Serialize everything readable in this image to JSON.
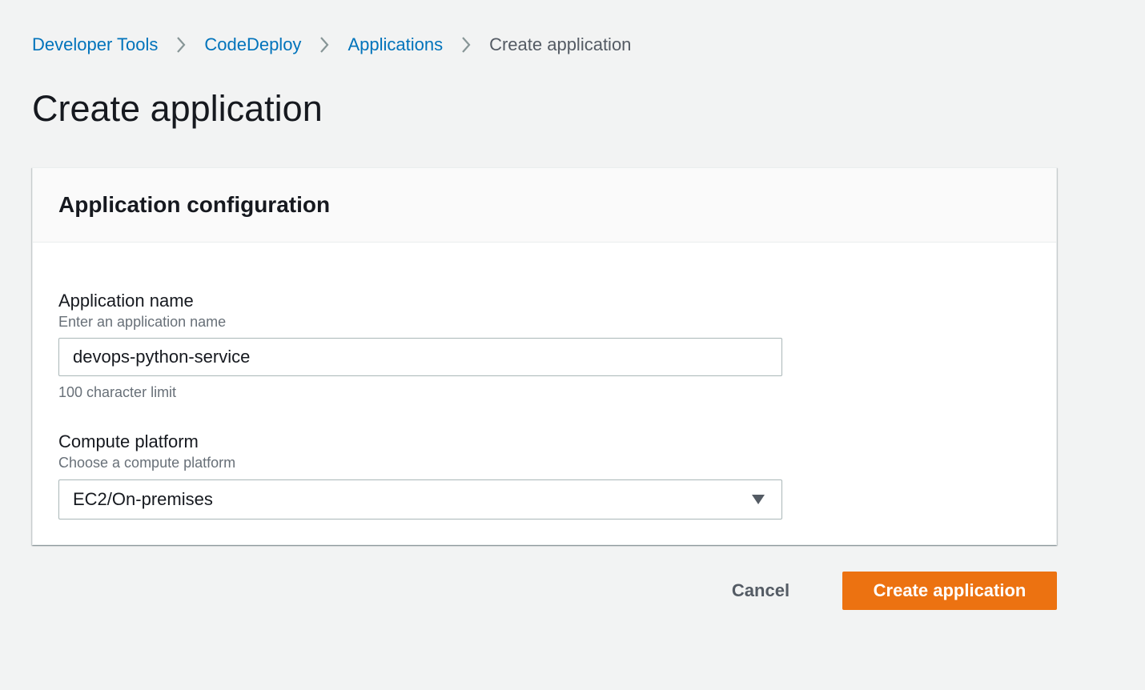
{
  "breadcrumb": {
    "items": [
      {
        "label": "Developer Tools"
      },
      {
        "label": "CodeDeploy"
      },
      {
        "label": "Applications"
      }
    ],
    "current": "Create application"
  },
  "page": {
    "title": "Create application"
  },
  "panel": {
    "title": "Application configuration",
    "app_name": {
      "label": "Application name",
      "description": "Enter an application name",
      "value": "devops-python-service",
      "constraint": "100 character limit"
    },
    "compute_platform": {
      "label": "Compute platform",
      "description": "Choose a compute platform",
      "selected": "EC2/On-premises"
    }
  },
  "actions": {
    "cancel_label": "Cancel",
    "create_label": "Create application"
  },
  "icons": {
    "breadcrumb_separator": "chevron-right-icon",
    "select_caret": "caret-down-icon"
  },
  "colors": {
    "background": "#f2f3f3",
    "link": "#0073bb",
    "primary_button": "#ec7211",
    "text": "#16191f",
    "secondary_text": "#687078"
  }
}
